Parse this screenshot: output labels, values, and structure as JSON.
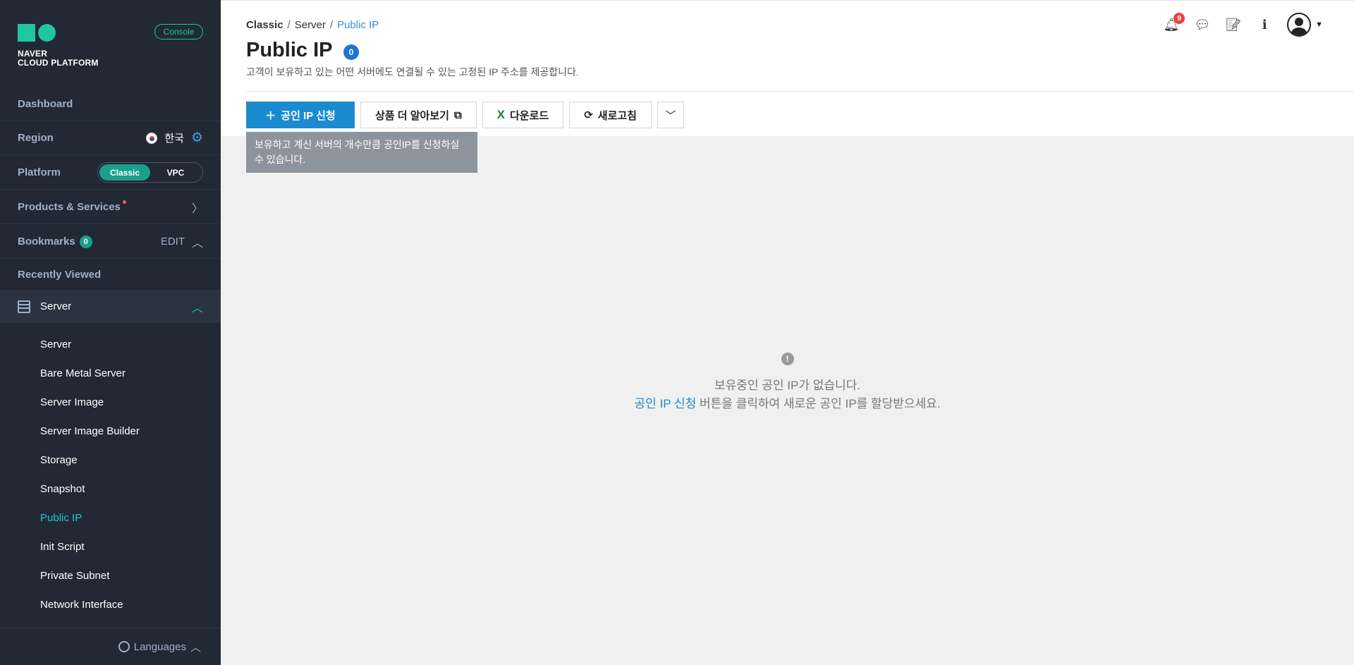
{
  "sidebar": {
    "logo_text_line1": "NAVER",
    "logo_text_line2": "CLOUD PLATFORM",
    "console_label": "Console",
    "dashboard": "Dashboard",
    "region_label": "Region",
    "region_value": "한국",
    "platform_label": "Platform",
    "platform_options": [
      "Classic",
      "VPC"
    ],
    "platform_selected": "Classic",
    "products_label": "Products & Services",
    "bookmarks_label": "Bookmarks",
    "bookmarks_count": "0",
    "bookmarks_edit": "EDIT",
    "recently_viewed": "Recently Viewed",
    "server_group": "Server",
    "sub_items": [
      "Server",
      "Bare Metal Server",
      "Server Image",
      "Server Image Builder",
      "Storage",
      "Snapshot",
      "Public IP",
      "Init Script",
      "Private Subnet",
      "Network Interface"
    ],
    "active_sub_item": "Public IP",
    "languages": "Languages"
  },
  "breadcrumb": [
    "Classic",
    "Server",
    "Public IP"
  ],
  "page": {
    "title": "Public IP",
    "count": "0",
    "description": "고객이 보유하고 있는 어떤 서버에도 연결될 수 있는 고정된 IP 주소를 제공합니다."
  },
  "toolbar": {
    "request_label": "공인 IP 신청",
    "learn_more_label": "상품 더 알아보기",
    "download_label": "다운로드",
    "refresh_label": "새로고침"
  },
  "tooltip": "보유하고 계신 서버의 개수만큼 공인IP를 신청하실 수 있습니다.",
  "notifications_count": "9",
  "empty_state": {
    "line1": "보유중인 공인 IP가 없습니다.",
    "link_text": "공인 IP 신청",
    "line2_rest": " 버튼을 클릭하여 새로운 공인 IP를 할당받으세요."
  },
  "colors": {
    "sidebar_bg": "#222834",
    "accent_green": "#1ec79f",
    "primary_blue": "#1b8bd0",
    "notif_red": "#e9443b"
  }
}
